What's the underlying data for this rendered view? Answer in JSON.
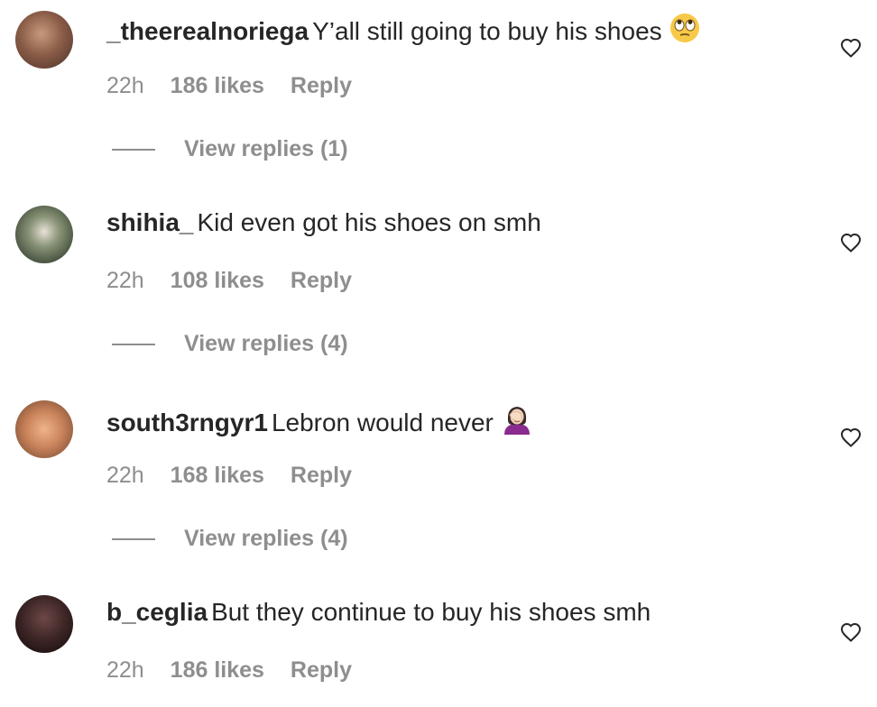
{
  "comments": [
    {
      "username": "_theerealnoriega",
      "text": "Y’all still going to buy his shoes",
      "emoji": "face-with-rolling-eyes",
      "time": "22h",
      "likes": "186 likes",
      "reply": "Reply",
      "view_replies": "View replies (1)",
      "avatar_colors": [
        "#b58a6e",
        "#5e3f33"
      ]
    },
    {
      "username": "shihia_",
      "text": "Kid even got his shoes on smh",
      "emoji": "",
      "time": "22h",
      "likes": "108 likes",
      "reply": "Reply",
      "view_replies": "View replies (4)",
      "avatar_colors": [
        "#7e8a6c",
        "#3d4a3a"
      ]
    },
    {
      "username": "south3rngyr1",
      "text": "Lebron would never",
      "emoji": "woman-facepalming",
      "time": "22h",
      "likes": "168 likes",
      "reply": "Reply",
      "view_replies": "View replies (4)",
      "avatar_colors": [
        "#e0a47a",
        "#8b5a3c"
      ]
    },
    {
      "username": "b_ceglia",
      "text": "But they continue to buy his shoes smh",
      "emoji": "",
      "time": "22h",
      "likes": "186 likes",
      "reply": "Reply",
      "view_replies": "",
      "avatar_colors": [
        "#5a3a3a",
        "#1f1414"
      ]
    }
  ]
}
